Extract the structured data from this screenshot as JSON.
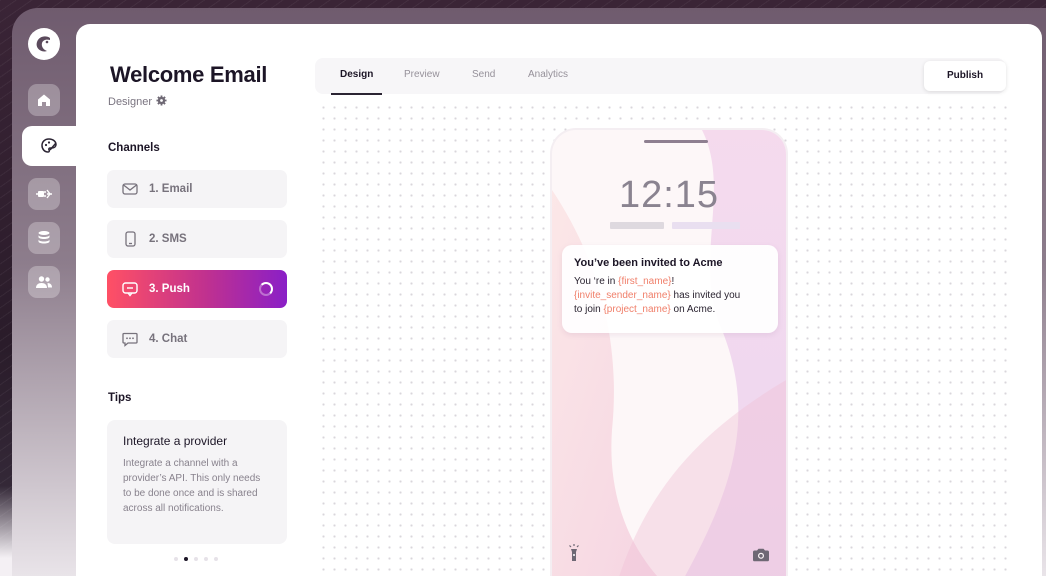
{
  "page": {
    "title": "Welcome Email",
    "subtitle": "Designer"
  },
  "channels": {
    "heading": "Channels",
    "items": [
      {
        "label": "1. Email",
        "icon": "envelope-icon"
      },
      {
        "label": "2. SMS",
        "icon": "mobile-icon"
      },
      {
        "label": "3. Push",
        "icon": "push-notification-icon",
        "active": true
      },
      {
        "label": "4. Chat",
        "icon": "chat-bubble-icon"
      }
    ]
  },
  "tips": {
    "heading": "Tips",
    "card_title": "Integrate a provider",
    "card_body": "Integrate a channel with a provider’s API. This only needs to be done once and is shared across all notifications.",
    "page_index": 2,
    "page_count": 5
  },
  "tabs": {
    "items": [
      "Design",
      "Preview",
      "Send",
      "Analytics"
    ],
    "active": "Design",
    "publish_label": "Publish"
  },
  "preview": {
    "time": "12:15",
    "notification": {
      "title": "You’ve been invited to Acme",
      "line1_prefix": "You ‘re in ",
      "first_name_var": "{first_name}",
      "line1_suffix": "!",
      "invite_sender_var": "{invite_sender_name}",
      "line2_suffix": " has invited you",
      "line3_prefix": "to join ",
      "project_var": "{project_name}",
      "line3_suffix": " on Acme."
    }
  },
  "colors": {
    "accent_gradient_start": "#ff5065",
    "accent_gradient_end": "#8a1fc7",
    "variable_highlight": "#f07f6a"
  }
}
